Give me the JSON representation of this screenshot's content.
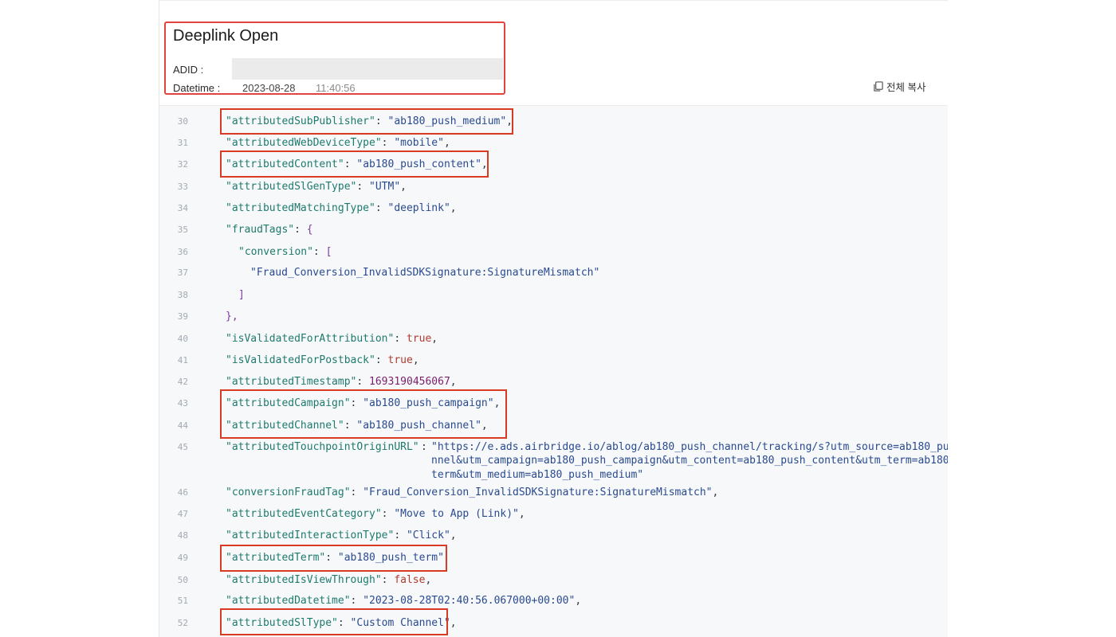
{
  "header": {
    "title": "Deeplink Open",
    "adid_label": "ADID :",
    "datetime_label": "Datetime :",
    "date": "2023-08-28",
    "time": "11:40:56"
  },
  "toolbar": {
    "copy_all_label": "전체 복사",
    "copy_icon": "copy-icon"
  },
  "colors": {
    "highlight": "#d93a23",
    "key": "#1f7a6e",
    "string": "#2a4a8f",
    "boolean": "#b23a2e",
    "number": "#7a1e6e"
  },
  "code_lines": [
    {
      "num": "30",
      "key": "\"attributedSubPublisher\"",
      "value": "\"ab180_push_medium\"",
      "end": ","
    },
    {
      "num": "31",
      "key": "\"attributedWebDeviceType\"",
      "value": "\"mobile\"",
      "end": ","
    },
    {
      "num": "32",
      "key": "\"attributedContent\"",
      "value": "\"ab180_push_content\"",
      "end": ","
    },
    {
      "num": "33",
      "key": "\"attributedSlGenType\"",
      "value": "\"UTM\"",
      "end": ","
    },
    {
      "num": "34",
      "key": "\"attributedMatchingType\"",
      "value": "\"deeplink\"",
      "end": ","
    },
    {
      "num": "35",
      "key": "\"fraudTags\"",
      "value": "{",
      "end": ""
    },
    {
      "num": "36",
      "key": "\"conversion\"",
      "value": "[",
      "end": ""
    },
    {
      "num": "37",
      "text": "\"Fraud_Conversion_InvalidSDKSignature:SignatureMismatch\""
    },
    {
      "num": "38",
      "text": "]"
    },
    {
      "num": "39",
      "text": "},"
    },
    {
      "num": "40",
      "key": "\"isValidatedForAttribution\"",
      "value": "true",
      "end": ","
    },
    {
      "num": "41",
      "key": "\"isValidatedForPostback\"",
      "value": "true",
      "end": ","
    },
    {
      "num": "42",
      "key": "\"attributedTimestamp\"",
      "value": "1693190456067",
      "end": ","
    },
    {
      "num": "43",
      "key": "\"attributedCampaign\"",
      "value": "\"ab180_push_campaign\"",
      "end": ","
    },
    {
      "num": "44",
      "key": "\"attributedChannel\"",
      "value": "\"ab180_push_channel\"",
      "end": ","
    },
    {
      "num": "45",
      "key": "\"attributedTouchpointOriginURL\"",
      "value": "\"https://e.ads.airbridge.io/ablog/ab180_push_channel/tracking/s?utm_source=ab180_pu",
      "value2": "nnel&utm_campaign=ab180_push_campaign&utm_content=ab180_push_content&utm_term=ab180",
      "value3": "term&utm_medium=ab180_push_medium\""
    },
    {
      "num": "46",
      "key": "\"conversionFraudTag\"",
      "value": "\"Fraud_Conversion_InvalidSDKSignature:SignatureMismatch\"",
      "end": ","
    },
    {
      "num": "47",
      "key": "\"attributedEventCategory\"",
      "value": "\"Move to App (Link)\"",
      "end": ","
    },
    {
      "num": "48",
      "key": "\"attributedInteractionType\"",
      "value": "\"Click\"",
      "end": ","
    },
    {
      "num": "49",
      "key": "\"attributedTerm\"",
      "value": "\"ab180_push_term\"",
      "end": ""
    },
    {
      "num": "50",
      "key": "\"attributedIsViewThrough\"",
      "value": "false",
      "end": ","
    },
    {
      "num": "51",
      "key": "\"attributedDatetime\"",
      "value": "\"2023-08-28T02:40:56.067000+00:00\"",
      "end": ","
    },
    {
      "num": "52",
      "key": "\"attributedSlType\"",
      "value": "\"Custom Channel\"",
      "end": ","
    }
  ]
}
